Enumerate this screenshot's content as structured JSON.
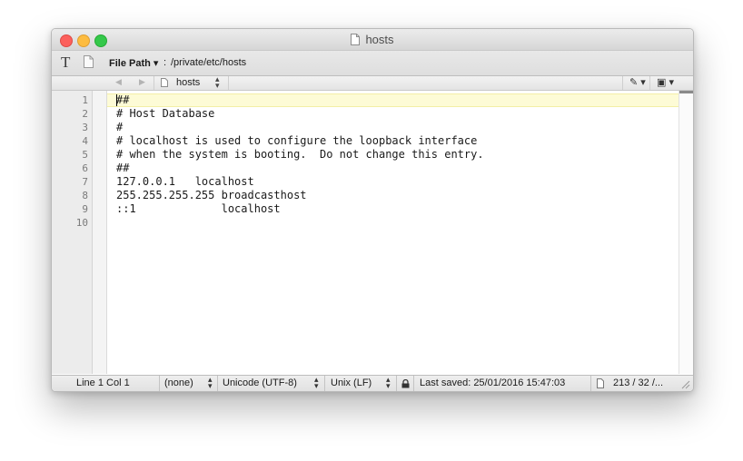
{
  "window": {
    "title": "hosts"
  },
  "toolbar": {
    "text_options_icon": "T",
    "filepath_label": "File Path ▾",
    "filepath_separator": ":",
    "filepath_value": "/private/etc/hosts"
  },
  "navbar": {
    "back_icon": "◀",
    "forward_icon": "▶",
    "filename": "hosts",
    "updown_icon": "▴▾",
    "pen_icon": "✎ ▾",
    "doc_menu_icon": "▣ ▾"
  },
  "editor": {
    "line_numbers": [
      "1",
      "2",
      "3",
      "4",
      "5",
      "6",
      "7",
      "8",
      "9",
      "10"
    ],
    "lines": [
      "##",
      "# Host Database",
      "#",
      "# localhost is used to configure the loopback interface",
      "# when the system is booting.  Do not change this entry.",
      "##",
      "127.0.0.1   localhost",
      "255.255.255.255 broadcasthost",
      "::1             localhost",
      ""
    ]
  },
  "status": {
    "position": "Line 1 Col 1",
    "language": "(none)",
    "encoding": "Unicode (UTF-8)",
    "line_endings": "Unix (LF)",
    "last_saved": "Last saved: 25/01/2016 15:47:03",
    "stats": "213 / 32 /..."
  },
  "colors": {
    "close": "#fc605c",
    "minimize": "#fdbc40",
    "zoom": "#34c84a",
    "current_line": "#fdfbd6"
  }
}
